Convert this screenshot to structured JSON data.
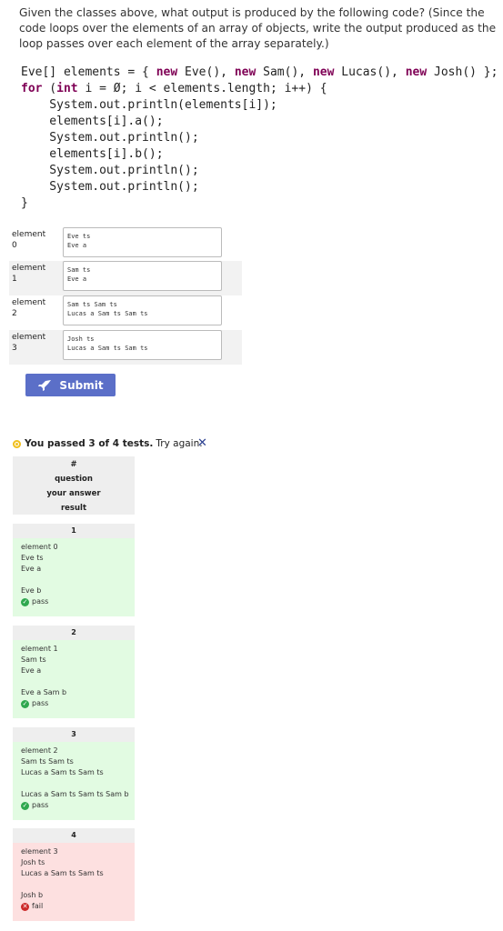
{
  "prompt": "Given the classes above, what output is produced by the following code? (Since the code loops over the elements of an array of objects, write the output produced as the loop passes over each element of the array separately.)",
  "code": {
    "line1_a": "Eve[] elements = { ",
    "kw_new1": "new",
    "line1_b": " Eve(), ",
    "kw_new2": "new",
    "line1_c": " Sam(), ",
    "kw_new3": "new",
    "line1_d": " Lucas(), ",
    "kw_new4": "new",
    "line1_e": " Josh() };",
    "kw_for": "for",
    "line2_a": " (",
    "kw_int": "int",
    "line2_b": " i = Ø; i < elements.length; i++) {",
    "body": "    System.out.println(elements[i]);\n    elements[i].a();\n    System.out.println();\n    elements[i].b();\n    System.out.println();\n    System.out.println();\n}"
  },
  "answers": [
    {
      "label": "element\n0",
      "value": "Eve ts\nEve a"
    },
    {
      "label": "element\n1",
      "value": "Sam ts\nEve a"
    },
    {
      "label": "element\n2",
      "value": "Sam ts Sam ts\nLucas a Sam ts Sam ts"
    },
    {
      "label": "element\n3",
      "value": "Josh ts\nLucas a Sam ts Sam ts"
    }
  ],
  "submit_label": "Submit",
  "status": {
    "bold": "You passed 3 of 4 tests.",
    "rest": "Try again.",
    "close": "✕"
  },
  "table_header": {
    "hash": "#",
    "question": "question",
    "answer": "your answer",
    "result": "result"
  },
  "tests": [
    {
      "num": "1",
      "q": "element 0",
      "a": "Eve ts\nEve a",
      "b": "Eve b",
      "result": "pass"
    },
    {
      "num": "2",
      "q": "element 1",
      "a": "Sam ts\nEve a",
      "b": "Eve a Sam b",
      "result": "pass"
    },
    {
      "num": "3",
      "q": "element 2",
      "a": "Sam ts Sam ts\nLucas a Sam ts Sam ts",
      "b": "Lucas a Sam ts Sam ts Sam b",
      "result": "pass"
    },
    {
      "num": "4",
      "q": "element 3",
      "a": "Josh ts\nLucas a Sam ts Sam ts",
      "b": "Josh b",
      "result": "fail"
    }
  ],
  "colors": {
    "submit": "#5b6fc8",
    "pass_bg": "#e2fbe2",
    "fail_bg": "#fde0e0",
    "pass_icon": "#2fa84f",
    "fail_icon": "#cc2a2a",
    "keyword": "#7f0055"
  },
  "icons": {
    "submit": "rocket-icon",
    "status": "warning-dot-icon",
    "pass": "check-circle-icon",
    "fail": "x-circle-icon"
  }
}
